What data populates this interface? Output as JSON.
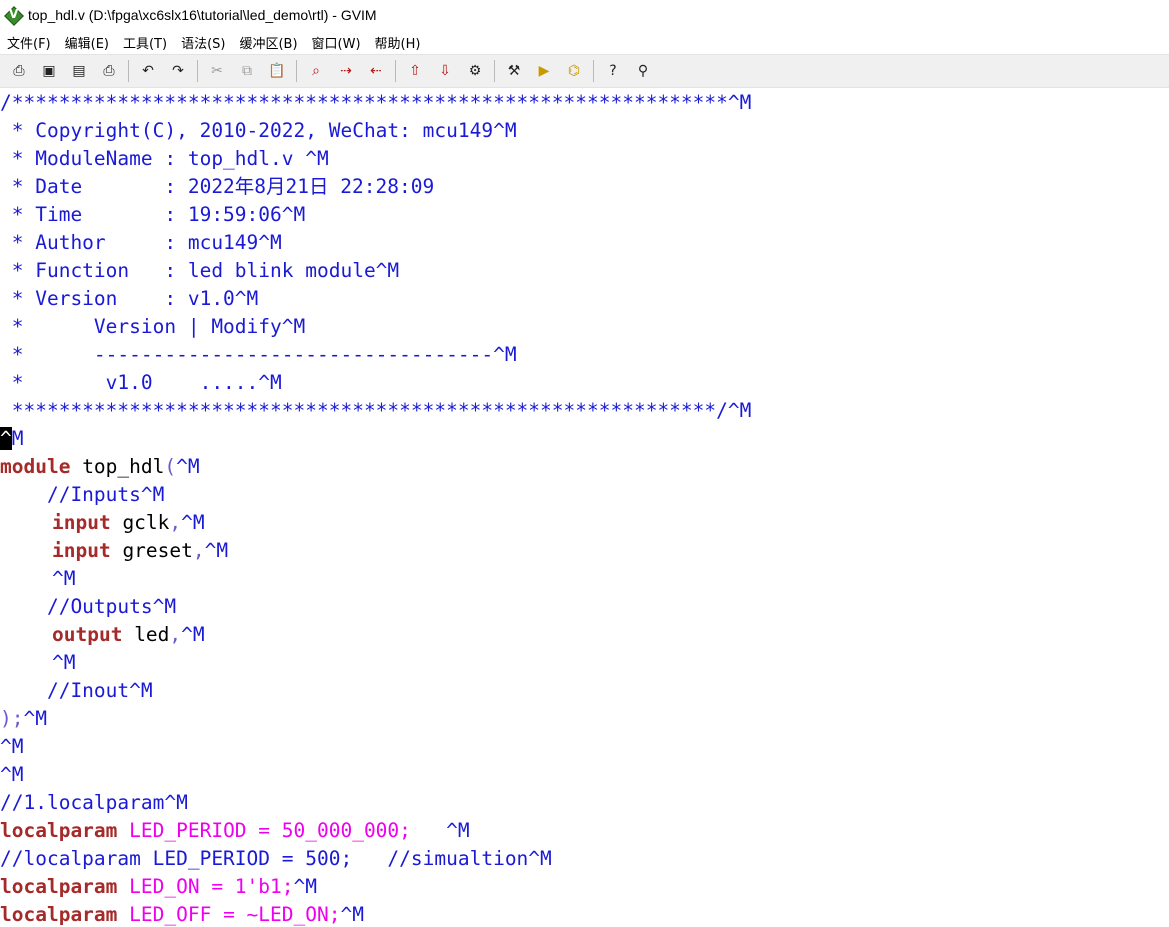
{
  "window": {
    "title": "top_hdl.v (D:\\fpga\\xc6slx16\\tutorial\\led_demo\\rtl) - GVIM"
  },
  "menu": [
    "文件(F)",
    "编辑(E)",
    "工具(T)",
    "语法(S)",
    "缓冲区(B)",
    "窗口(W)",
    "帮助(H)"
  ],
  "toolbar": {
    "glyphs": {
      "open": "⎙",
      "save": "▣",
      "save_all": "▤",
      "print": "⎙",
      "undo": "↶",
      "redo": "↷",
      "cut": "✂",
      "copy": "⧉",
      "paste": "📋",
      "find_replace": "⌕",
      "find_next": "⇢",
      "find_prev": "⇠",
      "load_session": "⇧",
      "save_session": "⇩",
      "run_script": "⚙",
      "make": "⚒",
      "shell": "▶",
      "tags": "⌬",
      "help": "?",
      "find_help": "⚲"
    },
    "icons": [
      "open-icon",
      "save-icon",
      "save-all-icon",
      "print-icon",
      "undo-icon",
      "redo-icon",
      "cut-icon",
      "copy-icon",
      "paste-icon",
      "find-replace-icon",
      "find-next-icon",
      "find-prev-icon",
      "load-session-icon",
      "save-session-icon",
      "run-script-icon",
      "make-icon",
      "shell-icon",
      "tag-jump-icon",
      "help-icon",
      "find-help-icon"
    ]
  },
  "code": {
    "l1": "/*************************************************************^M",
    "l2": " * Copyright(C), 2010-2022, WeChat: mcu149^M",
    "l3": " * ModuleName : top_hdl.v ^M",
    "l4": " * Date       : 2022年8月21日 22:28:09",
    "l5": " * Time       : 19:59:06^M",
    "l6": " * Author     : mcu149^M",
    "l7": " * Function   : led blink module^M",
    "l8": " * Version    : v1.0^M",
    "l9": " *      Version | Modify^M",
    "l10": " *      ----------------------------------^M",
    "l11": " *       v1.0    .....^M",
    "l12": " ************************************************************/^M",
    "l13_cursor": "^",
    "l13_rest": "M",
    "l14_kw": "module",
    "l14_id": " top_hdl",
    "l14_punc": "(",
    "l14_ctrl": "^M",
    "l15": "    //Inputs^M",
    "l16_kw": "input",
    "l16_id": " gclk",
    "l16_punc": ",",
    "l16_ctrl": "^M",
    "l17_kw": "input",
    "l17_id": " greset",
    "l17_punc": ",",
    "l17_ctrl": "^M",
    "l18": "^M",
    "l19": "    //Outputs^M",
    "l20_kw": "output",
    "l20_id": " led",
    "l20_punc": ",",
    "l20_ctrl": "^M",
    "l21": "^M",
    "l22": "    //Inout^M",
    "l23_punc": ");",
    "l23_ctrl": "^M",
    "l24": "^M",
    "l25": "^M",
    "l26": "//1.localparam^M",
    "l27_kw": "localparam",
    "l27_param": " LED_PERIOD = 50_000_000;",
    "l27_ctrl": "   ^M",
    "l28": "//localparam LED_PERIOD = 500;   //simualtion^M",
    "l29_kw": "localparam",
    "l29_param": " LED_ON = 1'b1;",
    "l29_ctrl": "^M",
    "l30_kw": "localparam",
    "l30_param": " LED_OFF = ~LED_ON;",
    "l30_ctrl": "^M"
  }
}
